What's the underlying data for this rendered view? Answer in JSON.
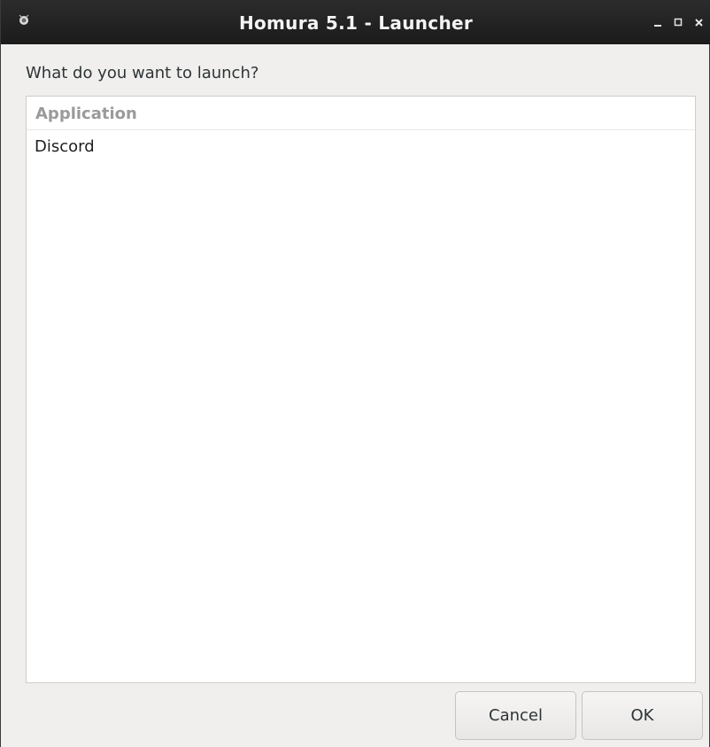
{
  "window": {
    "title": "Homura 5.1 - Launcher",
    "icons": {
      "app": "homura-app-icon",
      "minimize": "minimize-icon",
      "maximize": "maximize-icon",
      "close": "close-icon"
    }
  },
  "dialog": {
    "prompt": "What do you want to launch?",
    "list": {
      "column_header": "Application",
      "rows": [
        "Discord"
      ]
    },
    "buttons": {
      "cancel_label": "Cancel",
      "ok_label": "OK"
    }
  },
  "colors": {
    "titlebar": "#1b1b1b",
    "background": "#f0efed",
    "list_background": "#ffffff",
    "header_text": "#9a9a9a"
  }
}
